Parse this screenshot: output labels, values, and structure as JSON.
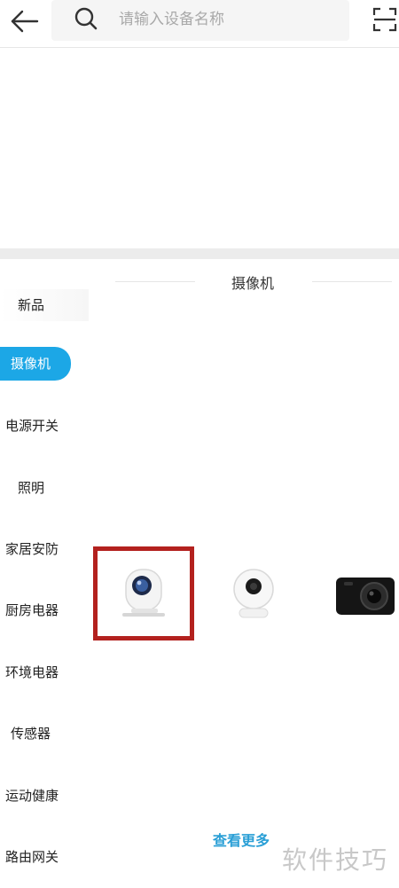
{
  "search": {
    "placeholder": "请输入设备名称"
  },
  "icons": {
    "back": "arrow-left-icon",
    "search": "search-icon",
    "scan": "scan-icon"
  },
  "content": {
    "section_title": "摄像机",
    "more_label": "查看更多"
  },
  "sidebar": {
    "items": [
      {
        "label": "新品"
      },
      {
        "label": "摄像机",
        "active": true
      },
      {
        "label": "电源开关"
      },
      {
        "label": "照明"
      },
      {
        "label": "家居安防"
      },
      {
        "label": "厨房电器"
      },
      {
        "label": "环境电器"
      },
      {
        "label": "传感器"
      },
      {
        "label": "运动健康"
      },
      {
        "label": "路由网关"
      }
    ]
  },
  "watermark": "软件技巧",
  "colors": {
    "accent": "#1ca7e6",
    "highlight": "#b3211e",
    "link": "#2a9fd6"
  }
}
